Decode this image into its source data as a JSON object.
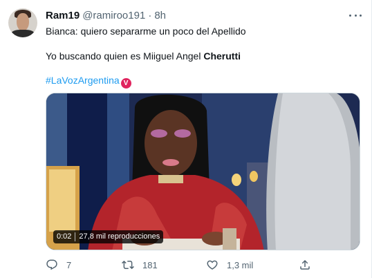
{
  "tweet": {
    "author_name": "Ram19",
    "author_handle": "@ramiroo191",
    "separator": "·",
    "timestamp": "8h",
    "text_line1": "Bianca: quiero separarme un poco del Apellido",
    "text_line2_prefix": "Yo buscando quien es Miiguel Angel ",
    "text_line2_bold": "Cherutti",
    "hashtag": "#LaVozArgentina",
    "hashtag_badge": "V"
  },
  "media": {
    "duration": "0:02",
    "views": "27,8 mil reproducciones"
  },
  "actions": {
    "reply_count": "7",
    "retweet_count": "181",
    "like_count": "1,3 mil"
  },
  "icons": {
    "avatar": "avatar",
    "more": "more-icon",
    "reply": "reply-icon",
    "retweet": "retweet-icon",
    "like": "heart-icon",
    "share": "share-icon"
  },
  "colors": {
    "accent": "#1d9bf0",
    "secondary_text": "#536471",
    "primary_text": "#0f1419",
    "badge": "#e0245e"
  }
}
